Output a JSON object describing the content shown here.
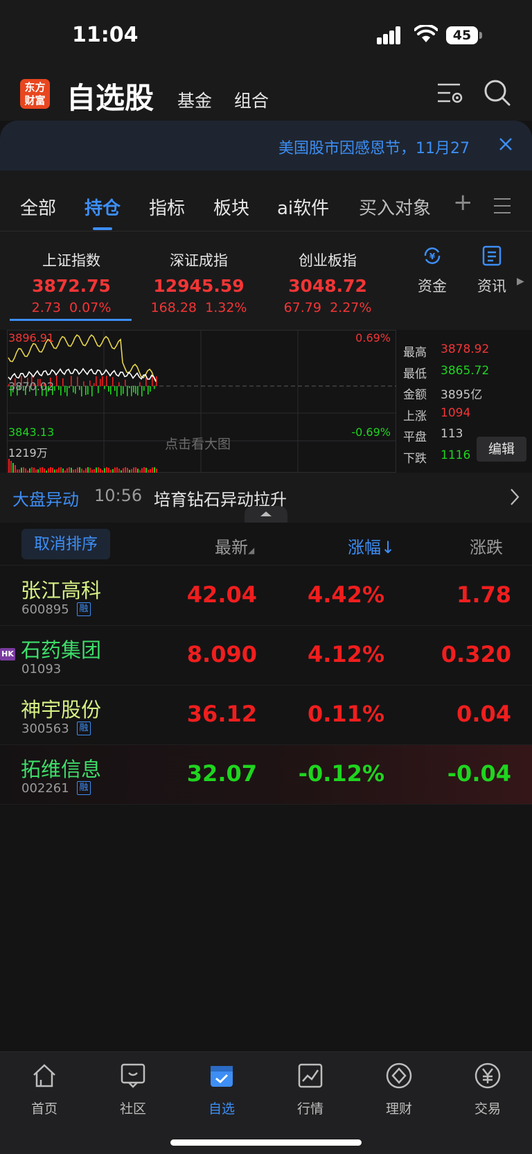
{
  "status_bar": {
    "time": "11:04",
    "battery": "45"
  },
  "header": {
    "logo_line1": "东方",
    "logo_line2": "财富",
    "title": "自选股",
    "tabs": [
      "基金",
      "组合"
    ],
    "icons": [
      "settings-list-icon",
      "search-icon"
    ]
  },
  "banner": {
    "text": "美国股市因感恩节，11月27"
  },
  "tabs": {
    "items": [
      "全部",
      "持仓",
      "指标",
      "板块",
      "ai软件",
      "买入对象"
    ],
    "active_index": 1,
    "plus": "+"
  },
  "indices": [
    {
      "name": "上证指数",
      "value": "3872.75",
      "change": "2.73",
      "pct": "0.07%"
    },
    {
      "name": "深证成指",
      "value": "12945.59",
      "change": "168.28",
      "pct": "1.32%"
    },
    {
      "name": "创业板指",
      "value": "3048.72",
      "change": "67.79",
      "pct": "2.27%"
    }
  ],
  "side_buttons": [
    {
      "label": "资金",
      "icon": "yuan-cycle-icon"
    },
    {
      "label": "资讯",
      "icon": "news-icon"
    }
  ],
  "chart": {
    "top_value": "3896.91",
    "bottom_value": "3843.13",
    "mid_value": "3870.02",
    "top_pct": "0.69%",
    "bottom_pct": "-0.69%",
    "volume_label": "1219万",
    "tap_hint": "点击看大图",
    "colors": {
      "index_line": "#ffffff",
      "avg_line": "#e6d44a",
      "up": "#f01e1e",
      "down": "#1fd51f"
    }
  },
  "stats": [
    {
      "label": "最高",
      "value": "3878.92",
      "color": "#f33535"
    },
    {
      "label": "最低",
      "value": "3865.72",
      "color": "#1fd51f"
    },
    {
      "label": "金额",
      "value": "3895亿",
      "color": "#c8c8c8"
    },
    {
      "label": "上涨",
      "value": "1094",
      "color": "#f33535"
    },
    {
      "label": "平盘",
      "value": "113",
      "color": "#c8c8c8"
    },
    {
      "label": "下跌",
      "value": "1116",
      "color": "#1fd51f"
    }
  ],
  "edit_label": "编辑",
  "alert": {
    "tag": "大盘异动",
    "time": "10:56",
    "text": "培育钻石异动拉升"
  },
  "list_header": {
    "sort_button": "取消排序",
    "col_price": "最新",
    "col_pct": "涨幅",
    "col_chg": "涨跌"
  },
  "stocks": [
    {
      "name": "张江高科",
      "code": "600895",
      "badge": "融",
      "price": "42.04",
      "pct": "4.42%",
      "chg": "1.78",
      "dir": "up",
      "hk": false
    },
    {
      "name": "石药集团",
      "code": "01093",
      "badge": "",
      "price": "8.090",
      "pct": "4.12%",
      "chg": "0.320",
      "dir": "up",
      "hk": true,
      "hk_label": "HK"
    },
    {
      "name": "神宇股份",
      "code": "300563",
      "badge": "融",
      "price": "36.12",
      "pct": "0.11%",
      "chg": "0.04",
      "dir": "up",
      "hk": false
    },
    {
      "name": "拓维信息",
      "code": "002261",
      "badge": "融",
      "price": "32.07",
      "pct": "-0.12%",
      "chg": "-0.04",
      "dir": "down",
      "hk": false
    }
  ],
  "bottom_nav": [
    {
      "label": "首页",
      "icon": "home-icon"
    },
    {
      "label": "社区",
      "icon": "chat-icon"
    },
    {
      "label": "自选",
      "icon": "watchlist-icon"
    },
    {
      "label": "行情",
      "icon": "chart-icon"
    },
    {
      "label": "理财",
      "icon": "diamond-icon"
    },
    {
      "label": "交易",
      "icon": "yuan-icon"
    }
  ],
  "bottom_nav_active": 2
}
